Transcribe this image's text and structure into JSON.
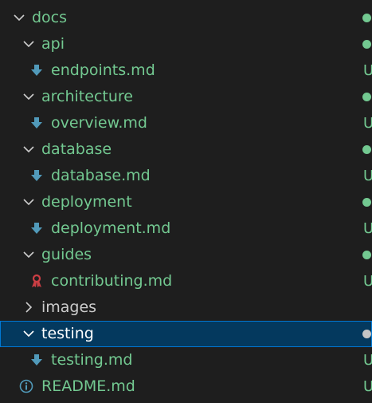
{
  "colors": {
    "background": "#1e1e1e",
    "untracked_text": "#73c991",
    "default_text": "#cccccc",
    "selected_row": "#04395e",
    "selected_text": "#ffffff",
    "modified_dot": "#73c991",
    "selected_dot": "#c5c5c5",
    "markdown_icon": "#519aba",
    "contributing_icon": "#cc3e44",
    "info_icon": "#519aba"
  },
  "explorer": {
    "items": [
      {
        "label": "docs",
        "type": "folder",
        "expanded": true,
        "icon": "chevron-down-icon",
        "status": "dot"
      },
      {
        "label": "api",
        "type": "folder",
        "expanded": true,
        "icon": "chevron-down-icon",
        "status": "dot"
      },
      {
        "label": "endpoints.md",
        "type": "file",
        "icon": "markdown-download-icon",
        "status": "U"
      },
      {
        "label": "architecture",
        "type": "folder",
        "expanded": true,
        "icon": "chevron-down-icon",
        "status": "dot"
      },
      {
        "label": "overview.md",
        "type": "file",
        "icon": "markdown-download-icon",
        "status": "U"
      },
      {
        "label": "database",
        "type": "folder",
        "expanded": true,
        "icon": "chevron-down-icon",
        "status": "dot"
      },
      {
        "label": "database.md",
        "type": "file",
        "icon": "markdown-download-icon",
        "status": "U"
      },
      {
        "label": "deployment",
        "type": "folder",
        "expanded": true,
        "icon": "chevron-down-icon",
        "status": "dot"
      },
      {
        "label": "deployment.md",
        "type": "file",
        "icon": "markdown-download-icon",
        "status": "U"
      },
      {
        "label": "guides",
        "type": "folder",
        "expanded": true,
        "icon": "chevron-down-icon",
        "status": "dot"
      },
      {
        "label": "contributing.md",
        "type": "file",
        "icon": "contributing-ribbon-icon",
        "status": "U"
      },
      {
        "label": "images",
        "type": "folder",
        "expanded": false,
        "icon": "chevron-right-icon",
        "status": ""
      },
      {
        "label": "testing",
        "type": "folder",
        "expanded": true,
        "icon": "chevron-down-icon",
        "status": "dot",
        "selected": true
      },
      {
        "label": "testing.md",
        "type": "file",
        "icon": "markdown-download-icon",
        "status": "U"
      },
      {
        "label": "README.md",
        "type": "file",
        "icon": "info-icon",
        "status": "U"
      }
    ]
  }
}
